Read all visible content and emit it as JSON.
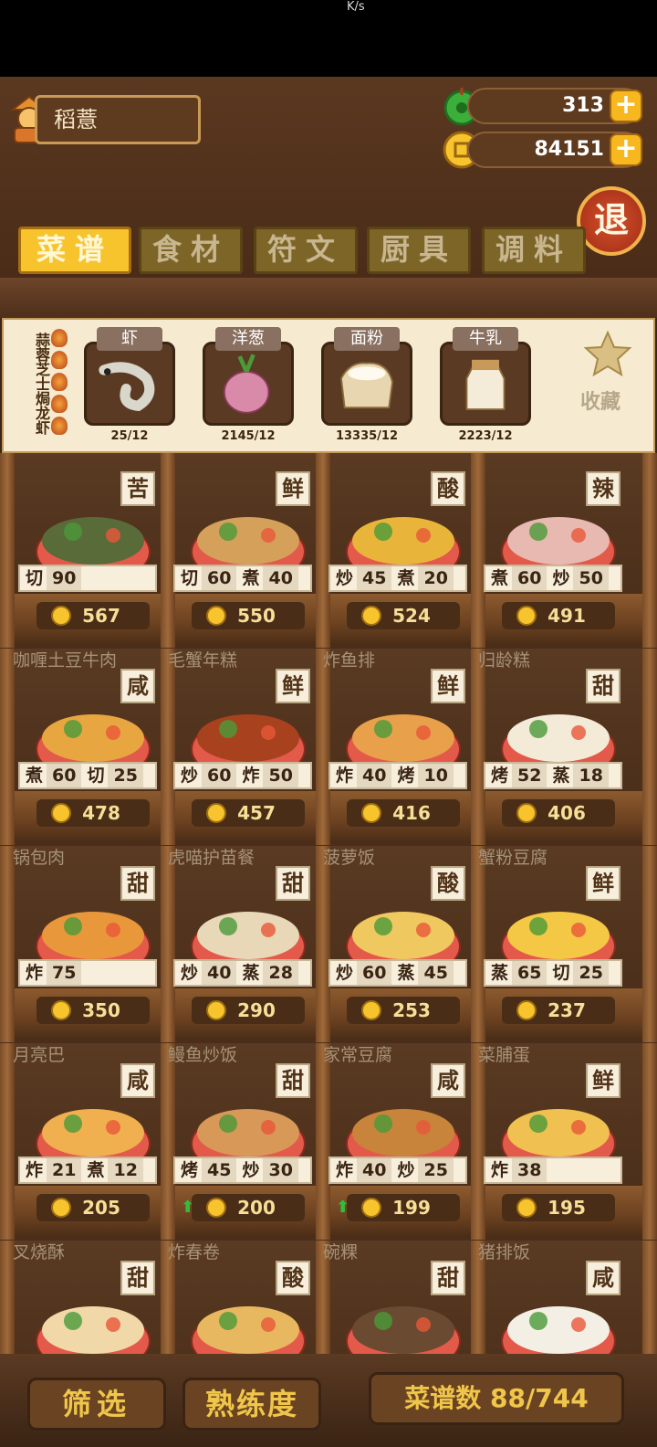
{
  "statusbar": {
    "speed": "K/s"
  },
  "player": {
    "name": "稻薏"
  },
  "resources": {
    "jade": "313",
    "coins": "84151"
  },
  "exit_label": "退",
  "tabs": [
    {
      "label": "菜谱",
      "active": true
    },
    {
      "label": "食材",
      "active": false
    },
    {
      "label": "符文",
      "active": false
    },
    {
      "label": "厨具",
      "active": false
    },
    {
      "label": "调料",
      "active": false
    }
  ],
  "selected_recipe": {
    "name": "蒜蓉芝士焗龙虾",
    "ingredients": [
      {
        "name": "虾",
        "count": "25/12",
        "icon": "shrimp-icon"
      },
      {
        "name": "洋葱",
        "count": "2145/12",
        "icon": "onion-icon"
      },
      {
        "name": "面粉",
        "count": "13335/12",
        "icon": "flour-icon"
      },
      {
        "name": "牛乳",
        "count": "2223/12",
        "icon": "milk-icon"
      }
    ],
    "collect_label": "收藏"
  },
  "recipes": [
    {
      "name": "",
      "taste": "苦",
      "skills": [
        [
          "切",
          "90"
        ]
      ],
      "price": "567",
      "up": false,
      "color": "#5a6b3a"
    },
    {
      "name": "",
      "taste": "鲜",
      "skills": [
        [
          "切",
          "60"
        ],
        [
          "煮",
          "40"
        ]
      ],
      "price": "550",
      "up": false,
      "color": "#d4a05a"
    },
    {
      "name": "",
      "taste": "酸",
      "skills": [
        [
          "炒",
          "45"
        ],
        [
          "煮",
          "20"
        ]
      ],
      "price": "524",
      "up": false,
      "color": "#e8b53a"
    },
    {
      "name": "",
      "taste": "辣",
      "skills": [
        [
          "煮",
          "60"
        ],
        [
          "炒",
          "50"
        ]
      ],
      "price": "491",
      "up": false,
      "color": "#e8b9b0"
    },
    {
      "name": "咖喱土豆牛肉",
      "taste": "咸",
      "skills": [
        [
          "煮",
          "60"
        ],
        [
          "切",
          "25"
        ]
      ],
      "price": "478",
      "up": false,
      "color": "#e8a640"
    },
    {
      "name": "毛蟹年糕",
      "taste": "鲜",
      "skills": [
        [
          "炒",
          "60"
        ],
        [
          "炸",
          "50"
        ]
      ],
      "price": "457",
      "up": false,
      "color": "#a8421e"
    },
    {
      "name": "炸鱼排",
      "taste": "鲜",
      "skills": [
        [
          "炸",
          "40"
        ],
        [
          "烤",
          "10"
        ]
      ],
      "price": "416",
      "up": false,
      "color": "#e8a04a"
    },
    {
      "name": "归龄糕",
      "taste": "甜",
      "skills": [
        [
          "烤",
          "52"
        ],
        [
          "蒸",
          "18"
        ]
      ],
      "price": "406",
      "up": false,
      "color": "#f4ead8"
    },
    {
      "name": "锅包肉",
      "taste": "甜",
      "skills": [
        [
          "炸",
          "75"
        ]
      ],
      "price": "350",
      "up": false,
      "color": "#e8983a"
    },
    {
      "name": "虎喵护苗餐",
      "taste": "甜",
      "skills": [
        [
          "炒",
          "40"
        ],
        [
          "蒸",
          "28"
        ]
      ],
      "price": "290",
      "up": false,
      "color": "#e8d8b8"
    },
    {
      "name": "菠萝饭",
      "taste": "酸",
      "skills": [
        [
          "炒",
          "60"
        ],
        [
          "蒸",
          "45"
        ]
      ],
      "price": "253",
      "up": false,
      "color": "#f0c860"
    },
    {
      "name": "蟹粉豆腐",
      "taste": "鲜",
      "skills": [
        [
          "蒸",
          "65"
        ],
        [
          "切",
          "25"
        ]
      ],
      "price": "237",
      "up": false,
      "color": "#f4c844"
    },
    {
      "name": "月亮巴",
      "taste": "咸",
      "skills": [
        [
          "炸",
          "21"
        ],
        [
          "煮",
          "12"
        ]
      ],
      "price": "205",
      "up": false,
      "color": "#f0b050"
    },
    {
      "name": "鳗鱼炒饭",
      "taste": "甜",
      "skills": [
        [
          "烤",
          "45"
        ],
        [
          "炒",
          "30"
        ]
      ],
      "price": "200",
      "up": true,
      "color": "#d89858"
    },
    {
      "name": "家常豆腐",
      "taste": "咸",
      "skills": [
        [
          "炸",
          "40"
        ],
        [
          "炒",
          "25"
        ]
      ],
      "price": "199",
      "up": true,
      "color": "#c8843a"
    },
    {
      "name": "菜脯蛋",
      "taste": "鲜",
      "skills": [
        [
          "炸",
          "38"
        ]
      ],
      "price": "195",
      "up": false,
      "color": "#f0c050"
    },
    {
      "name": "叉烧酥",
      "taste": "甜",
      "skills": [],
      "price": "",
      "up": false,
      "color": "#f0d8a8"
    },
    {
      "name": "炸春卷",
      "taste": "酸",
      "skills": [],
      "price": "",
      "up": false,
      "color": "#e8b860"
    },
    {
      "name": "碗粿",
      "taste": "甜",
      "skills": [],
      "price": "",
      "up": false,
      "color": "#6a4a30"
    },
    {
      "name": "猪排饭",
      "taste": "咸",
      "skills": [],
      "price": "",
      "up": false,
      "color": "#f4efe4"
    }
  ],
  "bottom": {
    "filter_label": "筛选",
    "proficiency_label": "熟练度",
    "recipe_count_label": "菜谱数 88/744"
  }
}
